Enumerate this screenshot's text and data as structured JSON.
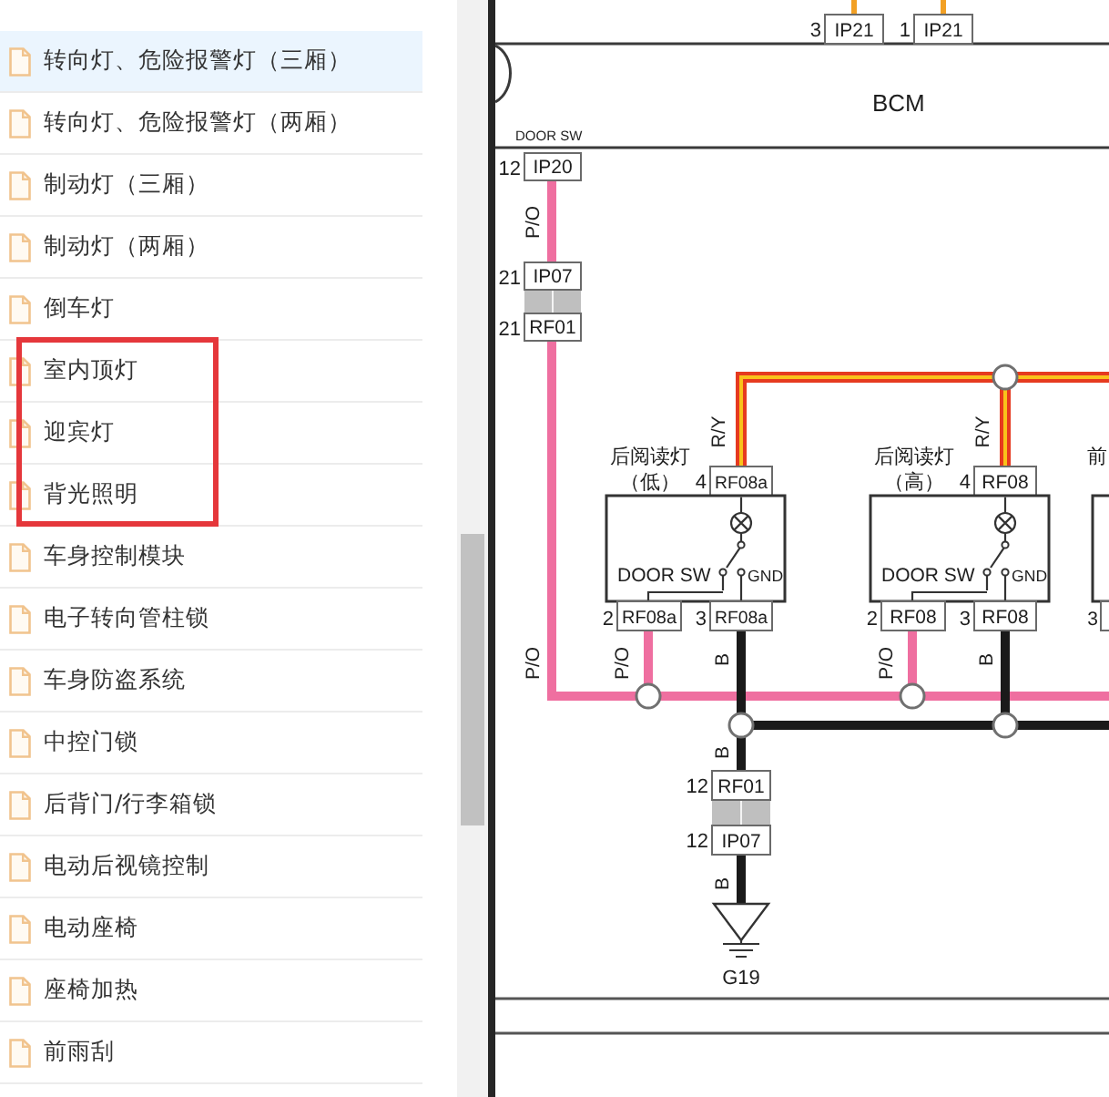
{
  "sidebar": {
    "items": [
      {
        "label": "转向灯、危险报警灯（三厢）",
        "selected": true,
        "boxed": false
      },
      {
        "label": "转向灯、危险报警灯（两厢）",
        "selected": false,
        "boxed": false
      },
      {
        "label": "制动灯（三厢）",
        "selected": false,
        "boxed": false
      },
      {
        "label": "制动灯（两厢）",
        "selected": false,
        "boxed": false
      },
      {
        "label": "倒车灯",
        "selected": false,
        "boxed": false
      },
      {
        "label": "室内顶灯",
        "selected": false,
        "boxed": true
      },
      {
        "label": "迎宾灯",
        "selected": false,
        "boxed": true
      },
      {
        "label": "背光照明",
        "selected": false,
        "boxed": true
      },
      {
        "label": "车身控制模块",
        "selected": false,
        "boxed": false
      },
      {
        "label": "电子转向管柱锁",
        "selected": false,
        "boxed": false
      },
      {
        "label": "车身防盗系统",
        "selected": false,
        "boxed": false
      },
      {
        "label": "中控门锁",
        "selected": false,
        "boxed": false
      },
      {
        "label": "后背门/行李箱锁",
        "selected": false,
        "boxed": false
      },
      {
        "label": "电动后视镜控制",
        "selected": false,
        "boxed": false
      },
      {
        "label": "电动座椅",
        "selected": false,
        "boxed": false
      },
      {
        "label": "座椅加热",
        "selected": false,
        "boxed": false
      },
      {
        "label": "前雨刮",
        "selected": false,
        "boxed": false
      }
    ]
  },
  "diagram": {
    "bcm": {
      "label": "BCM",
      "connectors": [
        {
          "pin": "3",
          "name": "IP21"
        },
        {
          "pin": "1",
          "name": "IP21"
        }
      ]
    },
    "door_switch_line": {
      "signal_label": "DOOR SW",
      "connectors": [
        {
          "pin": "12",
          "name": "IP20"
        },
        {
          "pin": "21",
          "name": "IP07"
        },
        {
          "pin": "21",
          "name": "RF01"
        }
      ],
      "wire_labels": [
        "P/O",
        "P/O"
      ]
    },
    "lamps": [
      {
        "title": "后阅读灯",
        "subtitle": "（低）",
        "top_connector": {
          "pin": "4",
          "name": "RF08a"
        },
        "supply_wire_label": "R/Y",
        "switch_label": "DOOR SW",
        "ground_pin_label": "GND",
        "bottom_connectors": [
          {
            "pin": "2",
            "name": "RF08a"
          },
          {
            "pin": "3",
            "name": "RF08a"
          }
        ],
        "bottom_wire_labels": [
          "P/O",
          "B"
        ]
      },
      {
        "title": "后阅读灯",
        "subtitle": "（高）",
        "top_connector": {
          "pin": "4",
          "name": "RF08"
        },
        "supply_wire_label": "R/Y",
        "switch_label": "DOOR SW",
        "ground_pin_label": "GND",
        "bottom_connectors": [
          {
            "pin": "2",
            "name": "RF08"
          },
          {
            "pin": "3",
            "name": "RF08"
          }
        ],
        "bottom_wire_labels": [
          "P/O",
          "B"
        ]
      }
    ],
    "cut_off_lamp": {
      "title": "前",
      "pin": "3"
    },
    "ground_line": {
      "wire_labels": [
        "B",
        "B"
      ],
      "connectors": [
        {
          "pin": "12",
          "name": "RF01"
        },
        {
          "pin": "12",
          "name": "IP07"
        }
      ],
      "ground_label": "G19"
    }
  }
}
